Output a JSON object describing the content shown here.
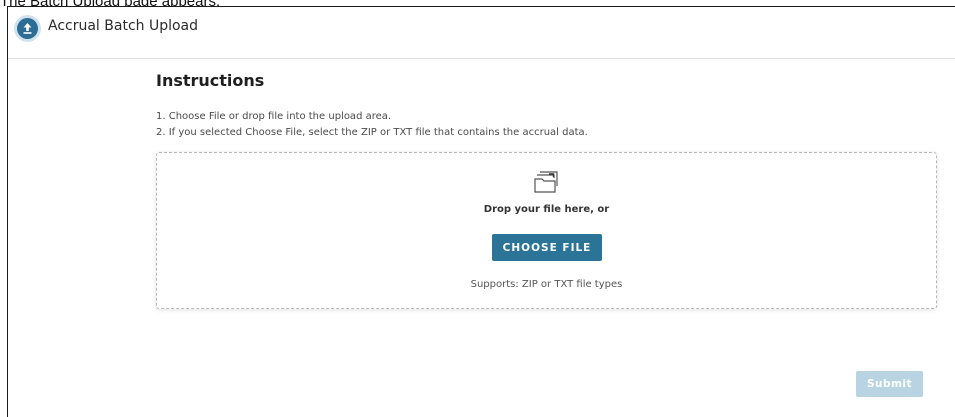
{
  "caption": "The Batch Upload page appears.",
  "header": {
    "title": "Accrual Batch Upload",
    "icon": "upload-icon",
    "icon_color": "#2d6d93"
  },
  "instructions": {
    "title": "Instructions",
    "steps": [
      "1. Choose File or drop file into the upload area.",
      "2. If you selected Choose File, select the ZIP or TXT file that contains the accrual data."
    ]
  },
  "dropzone": {
    "icon": "folder-icon",
    "drop_text": "Drop your file here, or",
    "choose_label": "CHOOSE FILE",
    "supports_text": "Supports: ZIP or TXT file types"
  },
  "actions": {
    "submit_label": "Submit",
    "submit_enabled": false
  },
  "colors": {
    "primary": "#2c7497",
    "disabled": "#b8d4e2"
  }
}
